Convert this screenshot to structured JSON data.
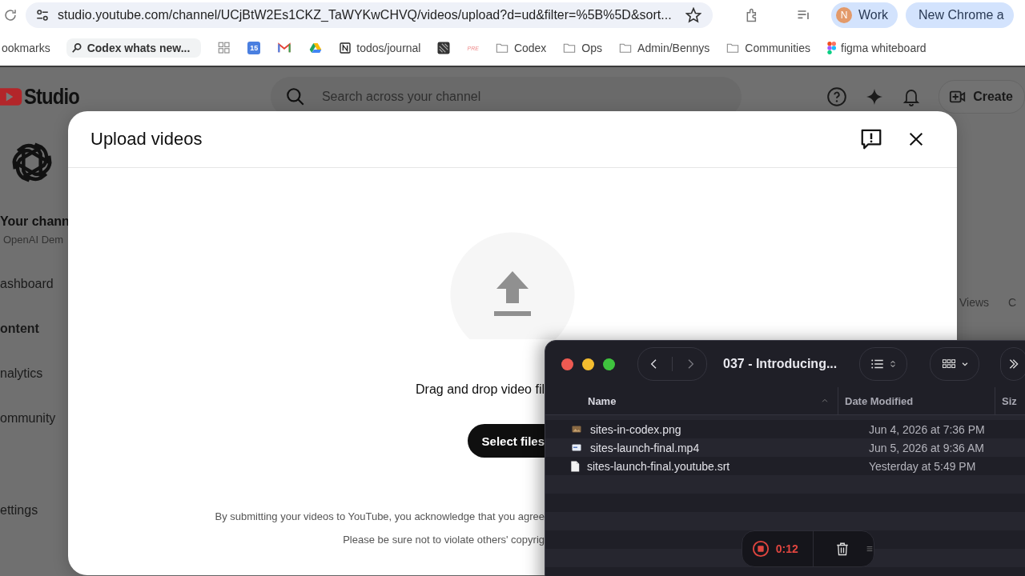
{
  "browser": {
    "url": "studio.youtube.com/channel/UCjBtW2Es1CKZ_TaWYKwCHVQ/videos/upload?d=ud&filter=%5B%5D&sort...",
    "profile": {
      "initial": "N",
      "name": "Work"
    },
    "new_tab_chip": "New Chrome a"
  },
  "bookmarks": [
    {
      "kind": "label",
      "label": "ookmarks"
    },
    {
      "kind": "search",
      "label": "Codex whats new..."
    },
    {
      "kind": "apps"
    },
    {
      "kind": "calendar",
      "label": "15"
    },
    {
      "kind": "mail"
    },
    {
      "kind": "drive"
    },
    {
      "kind": "notion",
      "label": "todos/journal"
    },
    {
      "kind": "app"
    },
    {
      "kind": "pre",
      "label": "PRE"
    },
    {
      "kind": "folder",
      "label": "Codex"
    },
    {
      "kind": "folder",
      "label": "Ops"
    },
    {
      "kind": "folder",
      "label": "Admin/Bennys"
    },
    {
      "kind": "folder",
      "label": "Communities"
    },
    {
      "kind": "figma",
      "label": "figma whiteboard"
    }
  ],
  "studio": {
    "logo": "Studio",
    "search_placeholder": "Search across your channel",
    "create": "Create",
    "channel_title": "Your chann",
    "channel_name": "OpenAI Dem",
    "nav": [
      {
        "label": "ashboard",
        "selected": false
      },
      {
        "label": "ontent",
        "selected": true
      },
      {
        "label": "nalytics",
        "selected": false
      },
      {
        "label": "ommunity",
        "selected": false
      }
    ],
    "settings": "ettings",
    "columns": [
      "Views",
      "C"
    ]
  },
  "upload_dialog": {
    "title": "Upload videos",
    "prompt": "Drag and drop video fil",
    "button": "Select files",
    "notice": [
      "By submitting your videos to YouTube, you acknowledge that you agree",
      "Please be sure not to violate others' copyrig"
    ]
  },
  "finder": {
    "title": "037 - Introducing...",
    "columns": [
      {
        "label": "Name",
        "sorted": true
      },
      {
        "label": "Date Modified",
        "sorted": false
      },
      {
        "label": "Siz",
        "sorted": false
      }
    ],
    "files": [
      {
        "name": "sites-in-codex.png",
        "date": "Jun 4, 2026 at 7:36 PM",
        "kind": "image"
      },
      {
        "name": "sites-launch-final.mp4",
        "date": "Jun 5, 2026 at 9:36 AM",
        "kind": "video"
      },
      {
        "name": "sites-launch-final.youtube.srt",
        "date": "Yesterday at 5:49 PM",
        "kind": "document"
      }
    ]
  },
  "recorder": {
    "time": "0:12"
  }
}
